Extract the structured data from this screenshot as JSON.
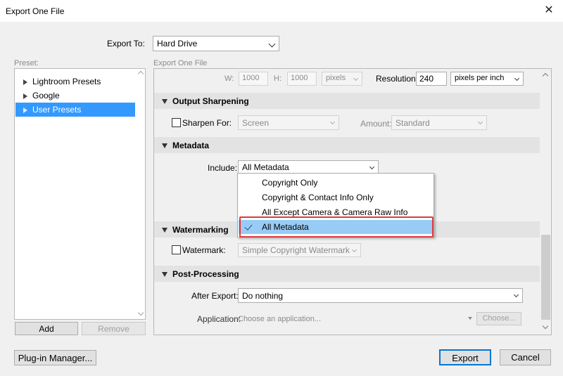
{
  "window": {
    "title": "Export One File",
    "close_glyph": "✕"
  },
  "export_to": {
    "label": "Export To:",
    "value": "Hard Drive"
  },
  "preset": {
    "label": "Preset:",
    "items": [
      {
        "label": "Lightroom Presets"
      },
      {
        "label": "Google"
      },
      {
        "label": "User Presets"
      }
    ],
    "add_label": "Add",
    "remove_label": "Remove"
  },
  "panel_title": "Export One File",
  "image_sizing": {
    "w_label": "W:",
    "w_value": "1000",
    "h_label": "H:",
    "h_value": "1000",
    "unit": "pixels",
    "resolution_label": "Resolution:",
    "resolution_value": "240",
    "resolution_unit": "pixels per inch"
  },
  "output_sharpening": {
    "title": "Output Sharpening",
    "sharpen_for_label": "Sharpen For:",
    "sharpen_for_value": "Screen",
    "amount_label": "Amount:",
    "amount_value": "Standard"
  },
  "metadata": {
    "title": "Metadata",
    "include_label": "Include:",
    "include_value": "All Metadata",
    "menu_items": [
      {
        "label": "Copyright Only"
      },
      {
        "label": "Copyright & Contact Info Only"
      },
      {
        "label": "All Except Camera & Camera Raw Info"
      },
      {
        "label": "All Metadata"
      }
    ]
  },
  "watermarking": {
    "title": "Watermarking",
    "watermark_label": "Watermark:",
    "watermark_value": "Simple Copyright Watermark"
  },
  "post_processing": {
    "title": "Post-Processing",
    "after_export_label": "After Export:",
    "after_export_value": "Do nothing",
    "application_label": "Application:",
    "application_placeholder": "Choose an application...",
    "choose_label": "Choose..."
  },
  "footer": {
    "plugin_manager_label": "Plug-in Manager...",
    "export_label": "Export",
    "cancel_label": "Cancel"
  },
  "colors": {
    "selection": "#3399ff",
    "menu_selection": "#99ccf5",
    "highlight_box": "#e03a3a",
    "default_button_border": "#0078d7"
  }
}
